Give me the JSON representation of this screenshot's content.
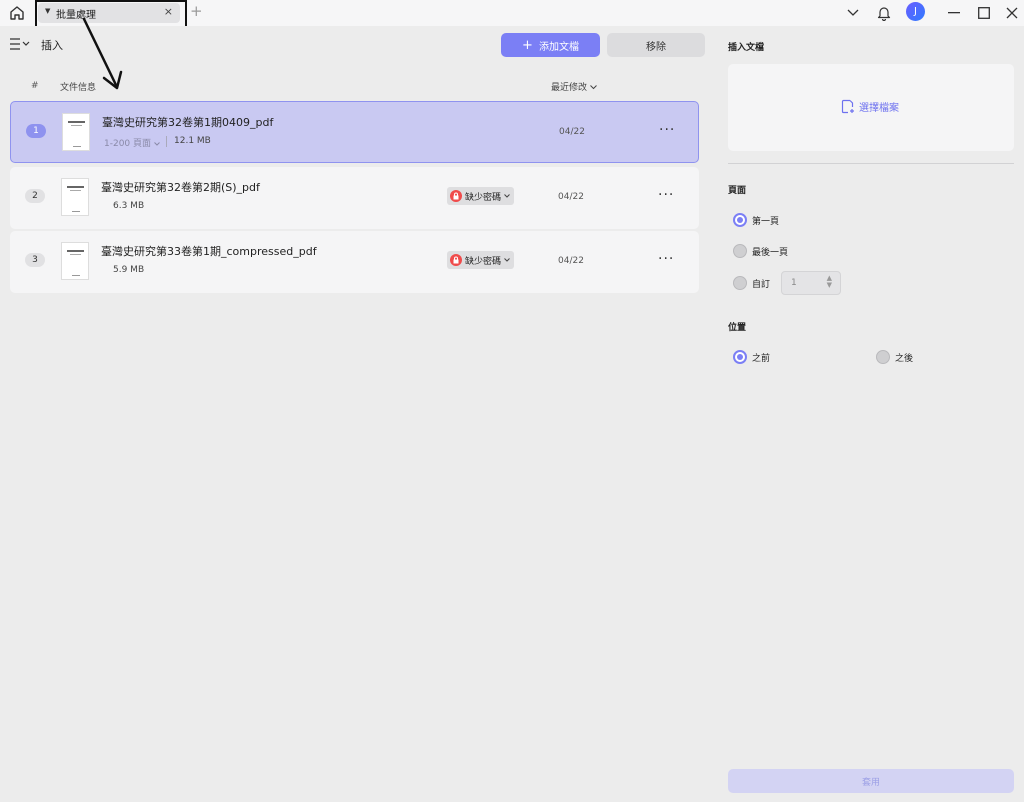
{
  "titlebar": {
    "tab_label": "批量處理",
    "tab_close": "×",
    "add_tab": "+",
    "avatar_letter": "J"
  },
  "left": {
    "title": "插入",
    "add_button": "添加文檔",
    "remove_button": "移除",
    "columns": {
      "hash": "#",
      "info": "文件信息",
      "modified": "最近修改"
    },
    "files": [
      {
        "num": "1",
        "name": "臺灣史研究第32卷第1期0409_pdf",
        "pages": "1-200 頁面",
        "size": "12.1 MB",
        "date": "04/22",
        "more": "···"
      },
      {
        "num": "2",
        "name": "臺灣史研究第32卷第2期(S)_pdf",
        "size": "6.3 MB",
        "badge": "缺少密碼",
        "date": "04/22",
        "more": "···"
      },
      {
        "num": "3",
        "name": "臺灣史研究第33卷第1期_compressed_pdf",
        "size": "5.9 MB",
        "badge": "缺少密碼",
        "date": "04/22",
        "more": "···"
      }
    ]
  },
  "right": {
    "insert_title": "插入文檔",
    "choose_file": "選擇檔案",
    "page_section": "頁面",
    "page_options": {
      "first": "第一頁",
      "last": "最後一頁",
      "custom": "自訂"
    },
    "custom_value": "1",
    "position_section": "位置",
    "position_options": {
      "before": "之前",
      "after": "之後"
    },
    "apply": "套用"
  },
  "colors": {
    "accent": "#7b7ff5",
    "selected_row": "#c9c9f2",
    "lock_red": "#f04b4b"
  }
}
